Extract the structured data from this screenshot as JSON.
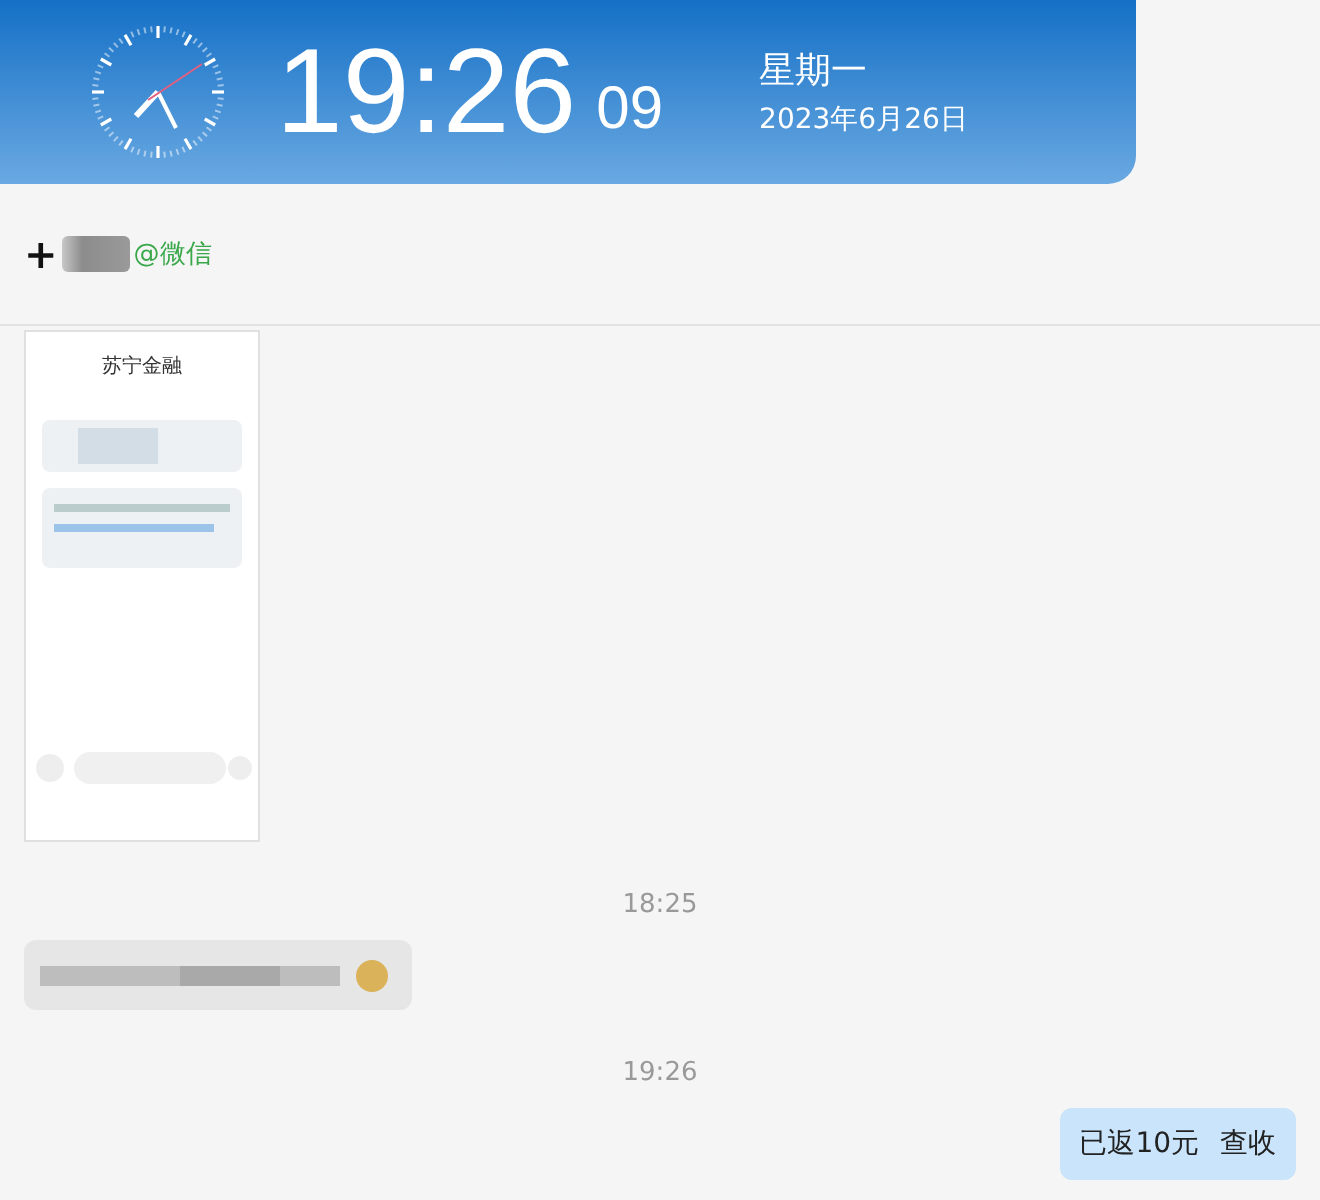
{
  "header": {
    "time": "19:26",
    "seconds": "09",
    "weekday": "星期一",
    "date": "2023年6月26日"
  },
  "contact": {
    "plus": "+",
    "name": "@微信"
  },
  "messages": [
    {
      "kind": "screenshot",
      "outgoing": false,
      "title": "苏宁金融"
    },
    {
      "kind": "timestamp",
      "text": "18:25"
    },
    {
      "kind": "blurred",
      "outgoing": false
    },
    {
      "kind": "timestamp",
      "text": "19:26"
    },
    {
      "kind": "text",
      "outgoing": true,
      "text": "已返10元 查收"
    }
  ]
}
